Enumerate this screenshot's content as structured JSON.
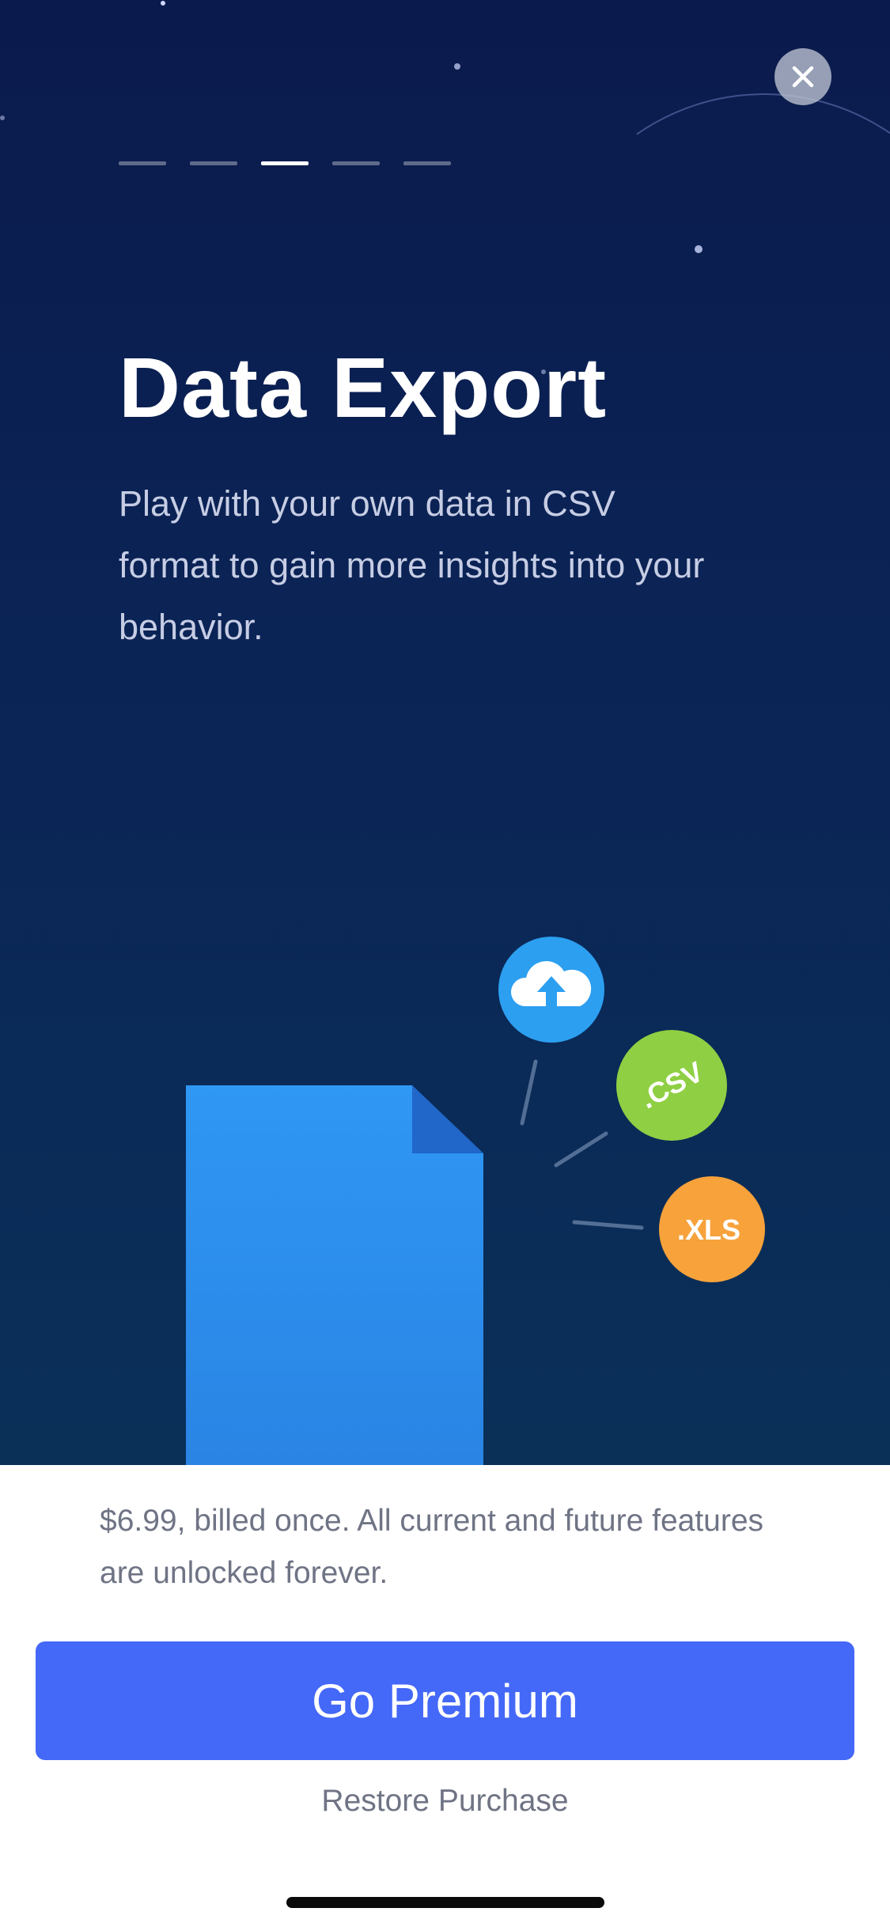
{
  "pager": {
    "total": 5,
    "active_index": 2
  },
  "feature": {
    "title": "Data Export",
    "description": "Play with your own data in CSV format to gain more insights into your behavior."
  },
  "badges": {
    "cloud_icon": "cloud-upload-icon",
    "csv_label": ".CSV",
    "xls_label": ".XLS"
  },
  "purchase": {
    "price_note": "$6.99, billed once. All current and future features are unlocked forever.",
    "cta_label": "Go Premium",
    "restore_label": "Restore Purchase"
  },
  "colors": {
    "background_top": "#0b1a4c",
    "background_bottom": "#0a3058",
    "accent": "#4468f8",
    "document": "#2a8cf0",
    "cloud_badge": "#2c9ff0",
    "csv_badge": "#8fcf43",
    "xls_badge": "#f7a23b"
  }
}
